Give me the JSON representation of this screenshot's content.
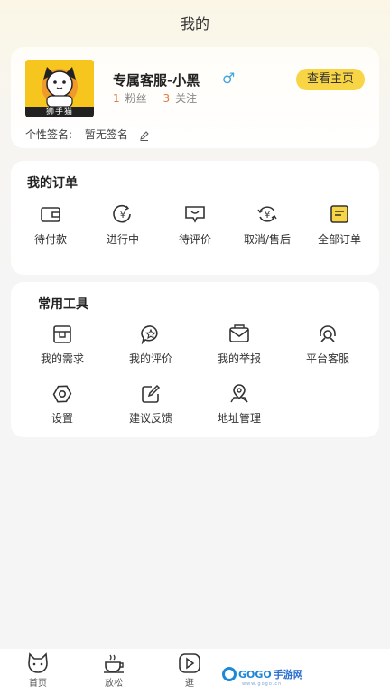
{
  "header": {
    "title": "我的"
  },
  "profile": {
    "avatar_label": "狮手猫",
    "name": "专属客服-小黑",
    "gender_symbol": "♂",
    "fans_count": "1",
    "fans_label": "粉丝",
    "follow_count": "3",
    "follow_label": "关注",
    "homepage_button": "查看主页",
    "signature_label": "个性签名:",
    "signature_value": "暂无签名"
  },
  "orders": {
    "title": "我的订单",
    "items": [
      {
        "label": "待付款",
        "icon": "wallet-icon"
      },
      {
        "label": "进行中",
        "icon": "yen-cycle-icon"
      },
      {
        "label": "待评价",
        "icon": "comment-smile-icon"
      },
      {
        "label": "取消/售后",
        "icon": "refund-icon"
      },
      {
        "label": "全部订单",
        "icon": "order-list-icon"
      }
    ]
  },
  "tools": {
    "title": "常用工具",
    "items": [
      {
        "label": "我的需求",
        "icon": "demand-box-icon"
      },
      {
        "label": "我的评价",
        "icon": "star-bubble-icon"
      },
      {
        "label": "我的举报",
        "icon": "report-mail-icon"
      },
      {
        "label": "平台客服",
        "icon": "headset-icon"
      },
      {
        "label": "设置",
        "icon": "settings-icon"
      },
      {
        "label": "建议反馈",
        "icon": "feedback-edit-icon"
      },
      {
        "label": "地址管理",
        "icon": "location-icon"
      }
    ]
  },
  "nav": {
    "items": [
      {
        "label": "首页",
        "icon": "cat-icon"
      },
      {
        "label": "放松",
        "icon": "coffee-icon"
      },
      {
        "label": "逛",
        "icon": "play-icon"
      }
    ]
  },
  "watermark": {
    "brand": "GOGO",
    "cn": "手游网",
    "sub": "www.gogo.cn"
  },
  "colors": {
    "accent": "#f8d545",
    "count": "#e07a3d",
    "gender": "#3fa3e4"
  }
}
